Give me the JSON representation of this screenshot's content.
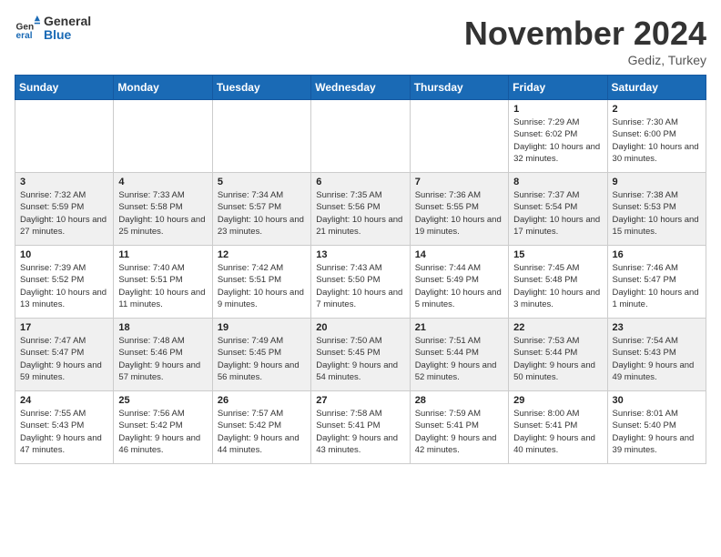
{
  "logo": {
    "general": "General",
    "blue": "Blue"
  },
  "title": "November 2024",
  "location": "Gediz, Turkey",
  "days_of_week": [
    "Sunday",
    "Monday",
    "Tuesday",
    "Wednesday",
    "Thursday",
    "Friday",
    "Saturday"
  ],
  "weeks": [
    [
      {
        "num": "",
        "info": ""
      },
      {
        "num": "",
        "info": ""
      },
      {
        "num": "",
        "info": ""
      },
      {
        "num": "",
        "info": ""
      },
      {
        "num": "",
        "info": ""
      },
      {
        "num": "1",
        "info": "Sunrise: 7:29 AM\nSunset: 6:02 PM\nDaylight: 10 hours and 32 minutes."
      },
      {
        "num": "2",
        "info": "Sunrise: 7:30 AM\nSunset: 6:00 PM\nDaylight: 10 hours and 30 minutes."
      }
    ],
    [
      {
        "num": "3",
        "info": "Sunrise: 7:32 AM\nSunset: 5:59 PM\nDaylight: 10 hours and 27 minutes."
      },
      {
        "num": "4",
        "info": "Sunrise: 7:33 AM\nSunset: 5:58 PM\nDaylight: 10 hours and 25 minutes."
      },
      {
        "num": "5",
        "info": "Sunrise: 7:34 AM\nSunset: 5:57 PM\nDaylight: 10 hours and 23 minutes."
      },
      {
        "num": "6",
        "info": "Sunrise: 7:35 AM\nSunset: 5:56 PM\nDaylight: 10 hours and 21 minutes."
      },
      {
        "num": "7",
        "info": "Sunrise: 7:36 AM\nSunset: 5:55 PM\nDaylight: 10 hours and 19 minutes."
      },
      {
        "num": "8",
        "info": "Sunrise: 7:37 AM\nSunset: 5:54 PM\nDaylight: 10 hours and 17 minutes."
      },
      {
        "num": "9",
        "info": "Sunrise: 7:38 AM\nSunset: 5:53 PM\nDaylight: 10 hours and 15 minutes."
      }
    ],
    [
      {
        "num": "10",
        "info": "Sunrise: 7:39 AM\nSunset: 5:52 PM\nDaylight: 10 hours and 13 minutes."
      },
      {
        "num": "11",
        "info": "Sunrise: 7:40 AM\nSunset: 5:51 PM\nDaylight: 10 hours and 11 minutes."
      },
      {
        "num": "12",
        "info": "Sunrise: 7:42 AM\nSunset: 5:51 PM\nDaylight: 10 hours and 9 minutes."
      },
      {
        "num": "13",
        "info": "Sunrise: 7:43 AM\nSunset: 5:50 PM\nDaylight: 10 hours and 7 minutes."
      },
      {
        "num": "14",
        "info": "Sunrise: 7:44 AM\nSunset: 5:49 PM\nDaylight: 10 hours and 5 minutes."
      },
      {
        "num": "15",
        "info": "Sunrise: 7:45 AM\nSunset: 5:48 PM\nDaylight: 10 hours and 3 minutes."
      },
      {
        "num": "16",
        "info": "Sunrise: 7:46 AM\nSunset: 5:47 PM\nDaylight: 10 hours and 1 minute."
      }
    ],
    [
      {
        "num": "17",
        "info": "Sunrise: 7:47 AM\nSunset: 5:47 PM\nDaylight: 9 hours and 59 minutes."
      },
      {
        "num": "18",
        "info": "Sunrise: 7:48 AM\nSunset: 5:46 PM\nDaylight: 9 hours and 57 minutes."
      },
      {
        "num": "19",
        "info": "Sunrise: 7:49 AM\nSunset: 5:45 PM\nDaylight: 9 hours and 56 minutes."
      },
      {
        "num": "20",
        "info": "Sunrise: 7:50 AM\nSunset: 5:45 PM\nDaylight: 9 hours and 54 minutes."
      },
      {
        "num": "21",
        "info": "Sunrise: 7:51 AM\nSunset: 5:44 PM\nDaylight: 9 hours and 52 minutes."
      },
      {
        "num": "22",
        "info": "Sunrise: 7:53 AM\nSunset: 5:44 PM\nDaylight: 9 hours and 50 minutes."
      },
      {
        "num": "23",
        "info": "Sunrise: 7:54 AM\nSunset: 5:43 PM\nDaylight: 9 hours and 49 minutes."
      }
    ],
    [
      {
        "num": "24",
        "info": "Sunrise: 7:55 AM\nSunset: 5:43 PM\nDaylight: 9 hours and 47 minutes."
      },
      {
        "num": "25",
        "info": "Sunrise: 7:56 AM\nSunset: 5:42 PM\nDaylight: 9 hours and 46 minutes."
      },
      {
        "num": "26",
        "info": "Sunrise: 7:57 AM\nSunset: 5:42 PM\nDaylight: 9 hours and 44 minutes."
      },
      {
        "num": "27",
        "info": "Sunrise: 7:58 AM\nSunset: 5:41 PM\nDaylight: 9 hours and 43 minutes."
      },
      {
        "num": "28",
        "info": "Sunrise: 7:59 AM\nSunset: 5:41 PM\nDaylight: 9 hours and 42 minutes."
      },
      {
        "num": "29",
        "info": "Sunrise: 8:00 AM\nSunset: 5:41 PM\nDaylight: 9 hours and 40 minutes."
      },
      {
        "num": "30",
        "info": "Sunrise: 8:01 AM\nSunset: 5:40 PM\nDaylight: 9 hours and 39 minutes."
      }
    ]
  ]
}
